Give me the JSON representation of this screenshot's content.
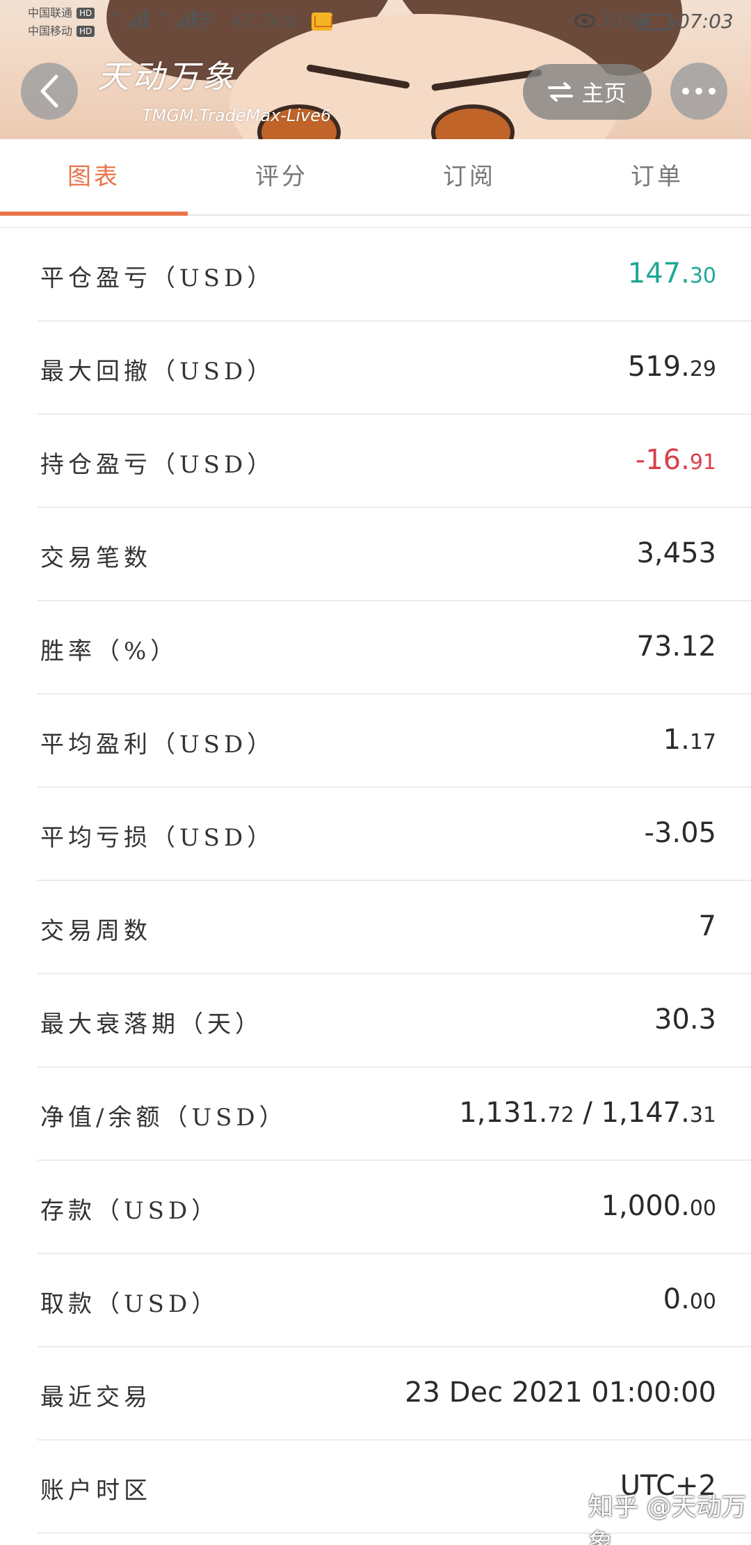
{
  "status_bar": {
    "carrier1": "中国联通",
    "carrier2": "中国移动",
    "hd_label": "HD",
    "network1": "4G",
    "network2": "4G",
    "net_speed": "42.7k/s",
    "battery": "30%",
    "time": "07:03"
  },
  "header": {
    "title": "天动万象",
    "subtitle": "TMGM.TradeMax-Live6",
    "home_label": "主页"
  },
  "tabs": [
    {
      "label": "图表",
      "active": true
    },
    {
      "label": "评分",
      "active": false
    },
    {
      "label": "订阅",
      "active": false
    },
    {
      "label": "订单",
      "active": false
    }
  ],
  "stats": [
    {
      "label": "平仓盈亏（USD）",
      "main": "147.",
      "frac": "30",
      "color": "green"
    },
    {
      "label": "最大回撤（USD）",
      "main": "519.",
      "frac": "29",
      "color": "normal"
    },
    {
      "label": "持仓盈亏（USD）",
      "main": "-16.",
      "frac": "91",
      "color": "red"
    },
    {
      "label": "交易笔数",
      "main": "3,453",
      "frac": "",
      "color": "normal"
    },
    {
      "label": "胜率（%）",
      "main": "73.12",
      "frac": "",
      "color": "normal"
    },
    {
      "label": "平均盈利（USD）",
      "main": "1.",
      "frac": "17",
      "color": "normal"
    },
    {
      "label": "平均亏损（USD）",
      "main": "-3.05",
      "frac": "",
      "color": "normal"
    },
    {
      "label": "交易周数",
      "main": "7",
      "frac": "",
      "color": "normal"
    },
    {
      "label": "最大衰落期（天）",
      "main": "30.3",
      "frac": "",
      "color": "normal"
    },
    {
      "label": "净值/余额（USD）",
      "main": "1,131.",
      "frac": "72",
      "main2": " / 1,147.",
      "frac2": "31",
      "color": "normal"
    },
    {
      "label": "存款（USD）",
      "main": "1,000.",
      "frac": "00",
      "color": "normal"
    },
    {
      "label": "取款（USD）",
      "main": "0.",
      "frac": "00",
      "color": "normal"
    },
    {
      "label": "最近交易",
      "main": "23 Dec 2021 01:00:00",
      "frac": "",
      "color": "normal"
    },
    {
      "label": "账户时区",
      "main": "UTC+2",
      "frac": "",
      "color": "normal"
    }
  ],
  "watermark": "知乎 @天动万象",
  "colors": {
    "accent": "#e8734a",
    "positive": "#1fa797",
    "negative": "#d9404c"
  }
}
